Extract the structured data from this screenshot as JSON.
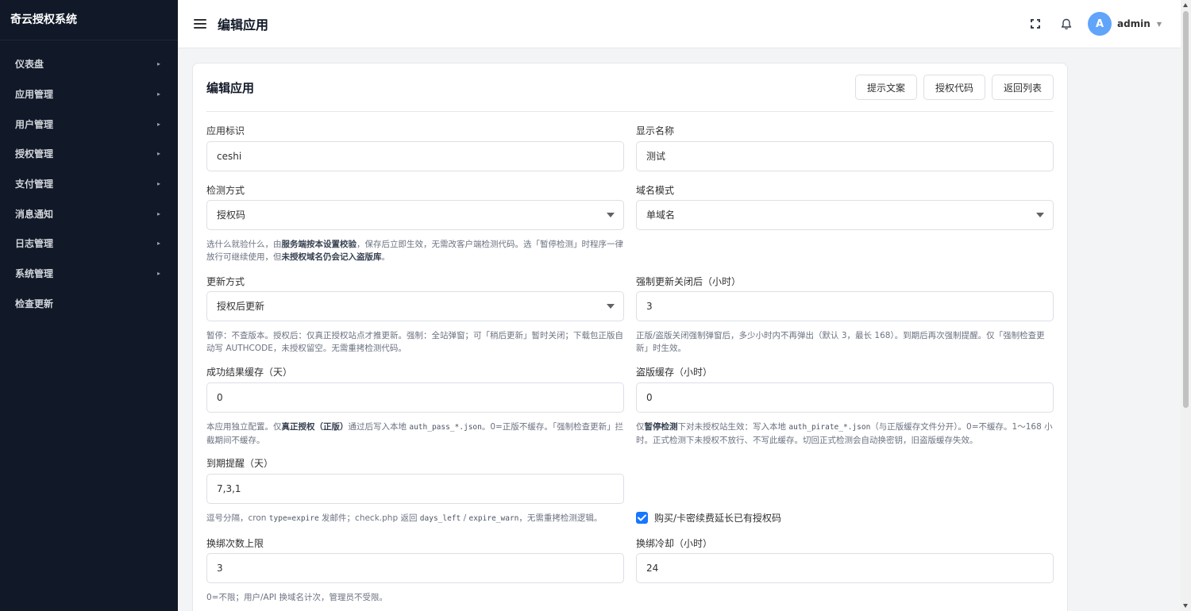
{
  "sidebar": {
    "brand": "奇云授权系统",
    "items": [
      {
        "label": "仪表盘",
        "has_arrow": true
      },
      {
        "label": "应用管理",
        "has_arrow": true
      },
      {
        "label": "用户管理",
        "has_arrow": true
      },
      {
        "label": "授权管理",
        "has_arrow": true
      },
      {
        "label": "支付管理",
        "has_arrow": true
      },
      {
        "label": "消息通知",
        "has_arrow": true
      },
      {
        "label": "日志管理",
        "has_arrow": true
      },
      {
        "label": "系统管理",
        "has_arrow": true
      },
      {
        "label": "检查更新",
        "has_arrow": false
      }
    ]
  },
  "header": {
    "title": "编辑应用",
    "avatar_letter": "A",
    "username": "admin"
  },
  "card": {
    "title": "编辑应用",
    "buttons": {
      "prompt_text": "提示文案",
      "auth_code": "授权代码",
      "back_to_list": "返回列表"
    }
  },
  "form": {
    "app_id": {
      "label": "应用标识",
      "value": "ceshi"
    },
    "display_name": {
      "label": "显示名称",
      "value": "测试"
    },
    "detect_mode": {
      "label": "检测方式",
      "value": "授权码",
      "help": {
        "p1": "选什么就验什么，由",
        "b1": "服务端按本设置校验",
        "p2": "，保存后立即生效，无需改客户端检测代码。选「暂停检测」时程序一律放行可继续使用，但",
        "b2": "未授权域名仍会记入盗版库",
        "p3": "。"
      }
    },
    "domain_mode": {
      "label": "域名模式",
      "value": "单域名"
    },
    "update_mode": {
      "label": "更新方式",
      "value": "授权后更新",
      "help": "暂停：不查版本。授权后：仅真正授权站点才推更新。强制：全站弹窗；可「稍后更新」暂时关闭；下载包正版自动写 AUTHCODE，未授权留空。无需重拷检测代码。"
    },
    "force_close_hours": {
      "label": "强制更新关闭后（小时）",
      "value": "3",
      "help": "正版/盗版关闭强制弹窗后，多少小时内不再弹出（默认 3，最长 168）。到期后再次强制提醒。仅「强制检查更新」时生效。"
    },
    "success_cache": {
      "label": "成功结果缓存（天）",
      "value": "0",
      "help": {
        "p1": "本应用独立配置。仅",
        "b1": "真正授权（正版）",
        "p2": "通过后写入本地 ",
        "code": "auth_pass_*.json",
        "p3": "。0=正版不缓存。「强制检查更新」拦截期间不缓存。"
      }
    },
    "pirate_cache": {
      "label": "盗版缓存（小时）",
      "value": "0",
      "help": {
        "p1": "仅",
        "b1": "暂停检测",
        "p2": "下对未授权站生效：写入本地 ",
        "code": "auth_pirate_*.json",
        "p3": "（与正版缓存文件分开）。0=不缓存。1～168 小时。正式检测下未授权不放行、不写此缓存。切回正式检测会自动换密钥，旧盗版缓存失效。"
      }
    },
    "expire_remind": {
      "label": "到期提醒（天）",
      "value": "7,3,1",
      "help": {
        "p1": "逗号分隔，cron ",
        "code1": "type=expire",
        "p2": " 发邮件；check.php 返回 ",
        "code2": "days_left",
        "p3": " / ",
        "code3": "expire_warn",
        "p4": "，无需重拷检测逻辑。"
      }
    },
    "extend_checkbox": {
      "label": "购买/卡密续费延长已有授权码",
      "checked": true
    },
    "rebind_limit": {
      "label": "换绑次数上限",
      "value": "3",
      "help": "0=不限；用户/API 换域名计次，管理员不受限。"
    },
    "rebind_cooldown": {
      "label": "换绑冷却（小时）",
      "value": "24"
    }
  },
  "colors": {
    "sidebar_bg": "#111827",
    "primary": "#1677ff",
    "avatar_bg": "#60a5fa"
  }
}
